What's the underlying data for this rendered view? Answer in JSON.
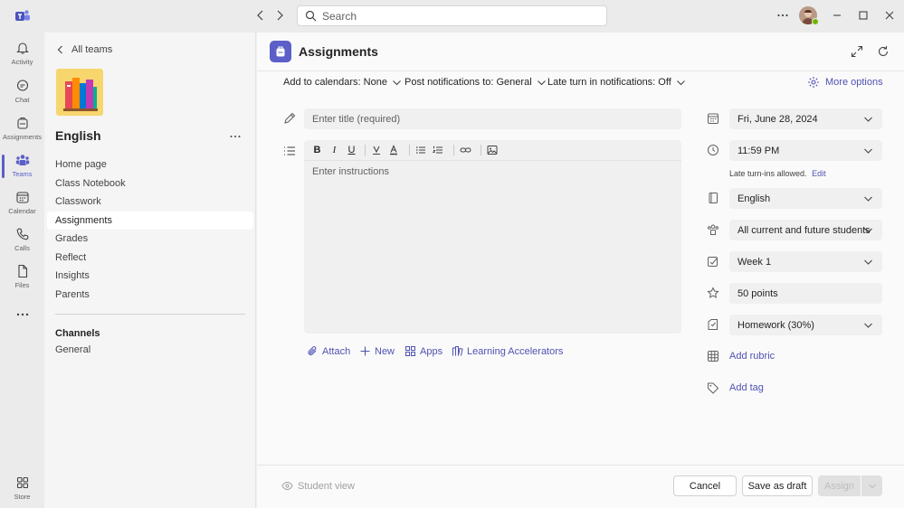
{
  "titlebar": {
    "search_placeholder": "Search"
  },
  "rail": {
    "items": [
      {
        "label": "Activity"
      },
      {
        "label": "Chat"
      },
      {
        "label": "Assignments"
      },
      {
        "label": "Teams"
      },
      {
        "label": "Calendar"
      },
      {
        "label": "Calls"
      },
      {
        "label": "Files"
      }
    ],
    "store_label": "Store"
  },
  "sidebar": {
    "back_label": "All teams",
    "team_name": "English",
    "nav_items": [
      {
        "label": "Home page"
      },
      {
        "label": "Class Notebook"
      },
      {
        "label": "Classwork"
      },
      {
        "label": "Assignments"
      },
      {
        "label": "Grades"
      },
      {
        "label": "Reflect"
      },
      {
        "label": "Insights"
      },
      {
        "label": "Parents"
      }
    ],
    "channels_heading": "Channels",
    "channels": [
      {
        "label": "General"
      }
    ]
  },
  "header": {
    "title": "Assignments"
  },
  "options_bar": {
    "calendar": "Add to calendars: None",
    "notifications": "Post notifications to: General",
    "late_turn_in": "Late turn in notifications: Off",
    "more_options": "More options"
  },
  "form": {
    "title_placeholder": "Enter title (required)",
    "instructions_placeholder": "Enter instructions",
    "attach_actions": {
      "attach": "Attach",
      "new": "New",
      "apps": "Apps",
      "learning_accelerators": "Learning Accelerators"
    }
  },
  "details": {
    "due_date": "Fri, June 28, 2024",
    "due_time": "11:59 PM",
    "late_note": "Late turn-ins allowed.",
    "late_edit": "Edit",
    "class": "English",
    "assign_to": "All current and future students",
    "category": "Week 1",
    "points": "50 points",
    "grading": "Homework (30%)",
    "add_rubric": "Add rubric",
    "add_tag": "Add tag"
  },
  "footer": {
    "student_view": "Student view",
    "cancel": "Cancel",
    "save_draft": "Save as draft",
    "assign": "Assign"
  },
  "colors": {
    "accent": "#5b5fc7",
    "link": "#4f52b2"
  }
}
